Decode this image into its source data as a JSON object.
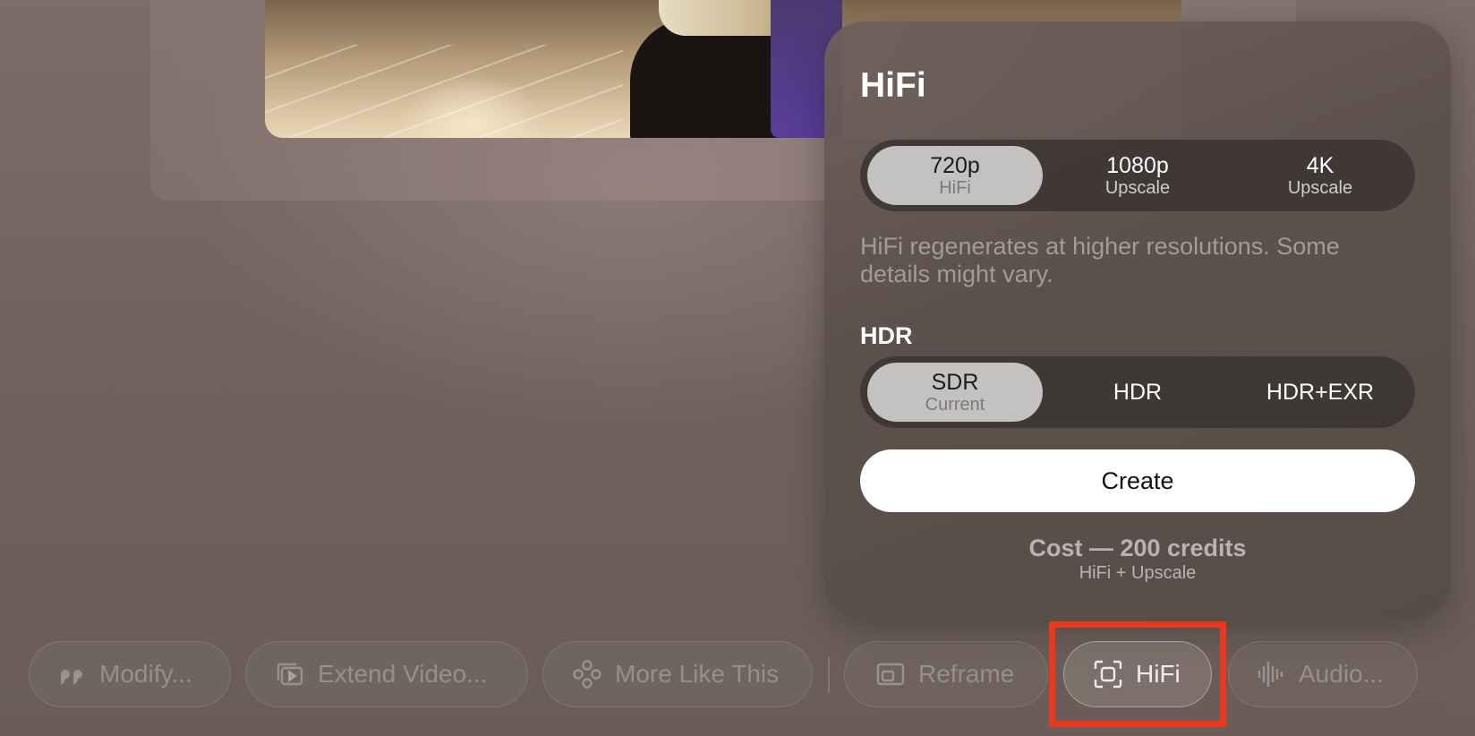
{
  "popover": {
    "title": "HiFi",
    "resolution_options": [
      {
        "main": "720p",
        "sub": "HiFi",
        "selected": true
      },
      {
        "main": "1080p",
        "sub": "Upscale",
        "selected": false
      },
      {
        "main": "4K",
        "sub": "Upscale",
        "selected": false
      }
    ],
    "description": "HiFi regenerates at higher resolutions. Some details might vary.",
    "hdr_label": "HDR",
    "hdr_options": [
      {
        "main": "SDR",
        "sub": "Current",
        "selected": true
      },
      {
        "main": "HDR",
        "sub": "",
        "selected": false
      },
      {
        "main": "HDR+EXR",
        "sub": "",
        "selected": false
      }
    ],
    "create_label": "Create",
    "cost_main": "Cost — 200 credits",
    "cost_sub": "HiFi + Upscale"
  },
  "toolbar": {
    "modify": {
      "label": "Modify...",
      "icon": "quote-icon"
    },
    "extend": {
      "label": "Extend Video...",
      "icon": "extend-video-icon"
    },
    "more": {
      "label": "More Like This",
      "icon": "more-like-this-icon"
    },
    "reframe": {
      "label": "Reframe",
      "icon": "reframe-icon"
    },
    "hifi": {
      "label": "HiFi",
      "icon": "focus-frame-icon",
      "active": true
    },
    "audio": {
      "label": "Audio...",
      "icon": "waveform-icon"
    }
  },
  "colors": {
    "highlight": "#e8391f",
    "create_button_bg": "#ffffff",
    "segment_active_bg": "#c4c2c0"
  }
}
